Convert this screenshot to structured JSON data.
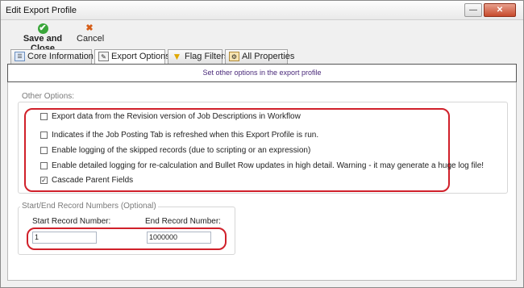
{
  "window": {
    "title": "Edit Export Profile"
  },
  "toolbar": {
    "save_label": "Save and Close",
    "cancel_label": "Cancel"
  },
  "tabs": [
    {
      "label": "Core Information",
      "icon": "core-info-icon"
    },
    {
      "label": "Export Options",
      "icon": "export-options-icon"
    },
    {
      "label": "Flag Filters",
      "icon": "funnel-icon"
    },
    {
      "label": "All Properties",
      "icon": "properties-icon"
    }
  ],
  "header": {
    "text": "Set other options in the export profile"
  },
  "other_options": {
    "legend": "Other Options:",
    "items": [
      {
        "label": "Export data from the Revision version of Job Descriptions in Workflow",
        "checked": false
      },
      {
        "label": "Indicates if the Job Posting Tab is refreshed when this Export Profile is run.",
        "checked": false
      },
      {
        "label": "Enable logging of the skipped records (due to scripting or an expression)",
        "checked": false
      },
      {
        "label": "Enable detailed logging for re-calculation and Bullet Row updates in high detail. Warning - it may generate a huge log file!",
        "checked": false
      },
      {
        "label": "Cascade Parent Fields",
        "checked": true
      }
    ]
  },
  "record_numbers": {
    "legend": "Start/End Record Numbers (Optional)",
    "start_label": "Start Record Number:",
    "start_value": "1",
    "end_label": "End Record Number:",
    "end_value": "1000000"
  },
  "colors": {
    "highlight": "#d0202a",
    "header_text": "#4a2a7a"
  }
}
